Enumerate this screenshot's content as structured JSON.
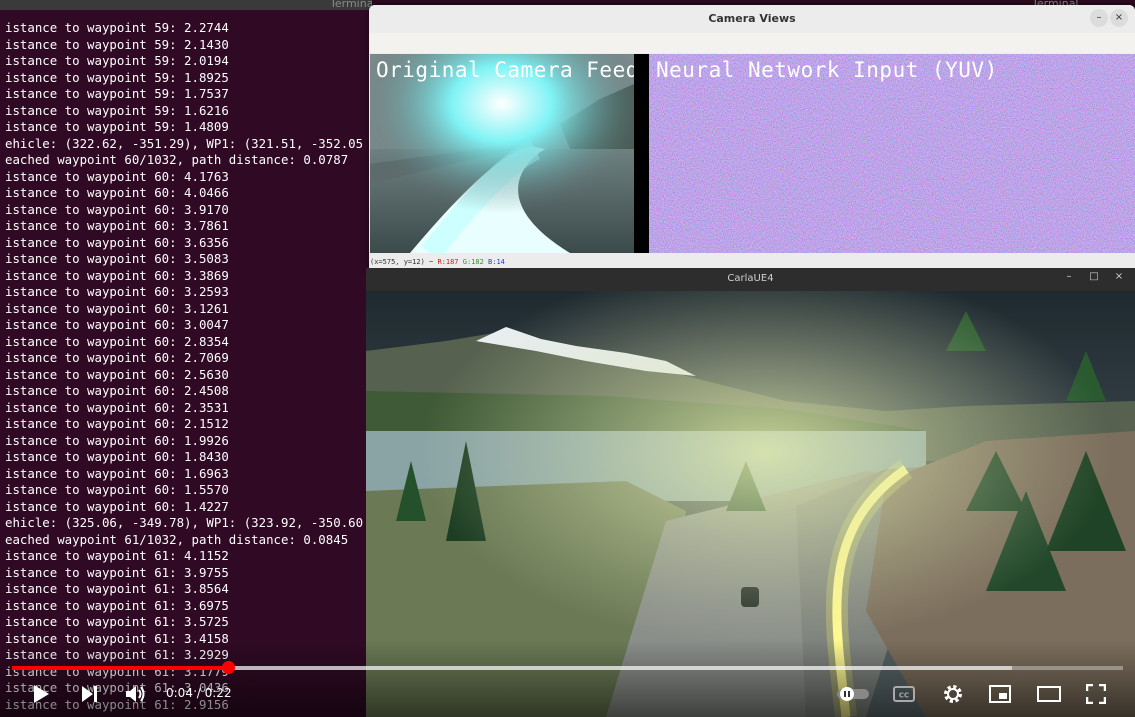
{
  "terminal": {
    "title": "Terminal",
    "right_title": "Terminal",
    "lines": [
      "istance to waypoint 59: 2.2744",
      "istance to waypoint 59: 2.1430",
      "istance to waypoint 59: 2.0194",
      "istance to waypoint 59: 1.8925",
      "istance to waypoint 59: 1.7537",
      "istance to waypoint 59: 1.6216",
      "istance to waypoint 59: 1.4809",
      "ehicle: (322.62, -351.29), WP1: (321.51, -352.05",
      "eached waypoint 60/1032, path distance: 0.0787",
      "istance to waypoint 60: 4.1763",
      "istance to waypoint 60: 4.0466",
      "istance to waypoint 60: 3.9170",
      "istance to waypoint 60: 3.7861",
      "istance to waypoint 60: 3.6356",
      "istance to waypoint 60: 3.5083",
      "istance to waypoint 60: 3.3869",
      "istance to waypoint 60: 3.2593",
      "istance to waypoint 60: 3.1261",
      "istance to waypoint 60: 3.0047",
      "istance to waypoint 60: 2.8354",
      "istance to waypoint 60: 2.7069",
      "istance to waypoint 60: 2.5630",
      "istance to waypoint 60: 2.4508",
      "istance to waypoint 60: 2.3531",
      "istance to waypoint 60: 2.1512",
      "istance to waypoint 60: 1.9926",
      "istance to waypoint 60: 1.8430",
      "istance to waypoint 60: 1.6963",
      "istance to waypoint 60: 1.5570",
      "istance to waypoint 60: 1.4227",
      "ehicle: (325.06, -349.78), WP1: (323.92, -350.60",
      "eached waypoint 61/1032, path distance: 0.0845",
      "istance to waypoint 61: 4.1152",
      "istance to waypoint 61: 3.9755",
      "istance to waypoint 61: 3.8564",
      "istance to waypoint 61: 3.6975",
      "istance to waypoint 61: 3.5725",
      "istance to waypoint 61: 3.4158",
      "istance to waypoint 61: 3.2929",
      "istance to waypoint 61: 3.1779",
      "istance to waypoint 61: 3.0436",
      "istance to waypoint 61: 2.9156"
    ]
  },
  "camera_window": {
    "title": "Camera Views",
    "label_original": "Original Camera Feed",
    "label_nn": "Neural Network Input (YUV)",
    "status_coords": "(x=575, y=12) ~ ",
    "status_r": "R:187",
    "status_g": "G:182",
    "status_b": "B:14",
    "minimize_glyph": "–",
    "close_glyph": "×"
  },
  "carla_window": {
    "title": "CarlaUE4",
    "minimize_glyph": "–",
    "maximize_glyph": "□",
    "close_glyph": "×"
  },
  "player": {
    "current_time": "0:04",
    "separator": " / ",
    "duration": "0:22",
    "progress_fraction": 0.194,
    "buffered_fraction": 0.9,
    "colors": {
      "progress": "#ff0000"
    },
    "icons": [
      "play-icon",
      "next-icon",
      "volume-icon",
      "autoplay-toggle",
      "captions-icon",
      "settings-icon",
      "miniplayer-icon",
      "theater-icon",
      "fullscreen-icon"
    ]
  }
}
